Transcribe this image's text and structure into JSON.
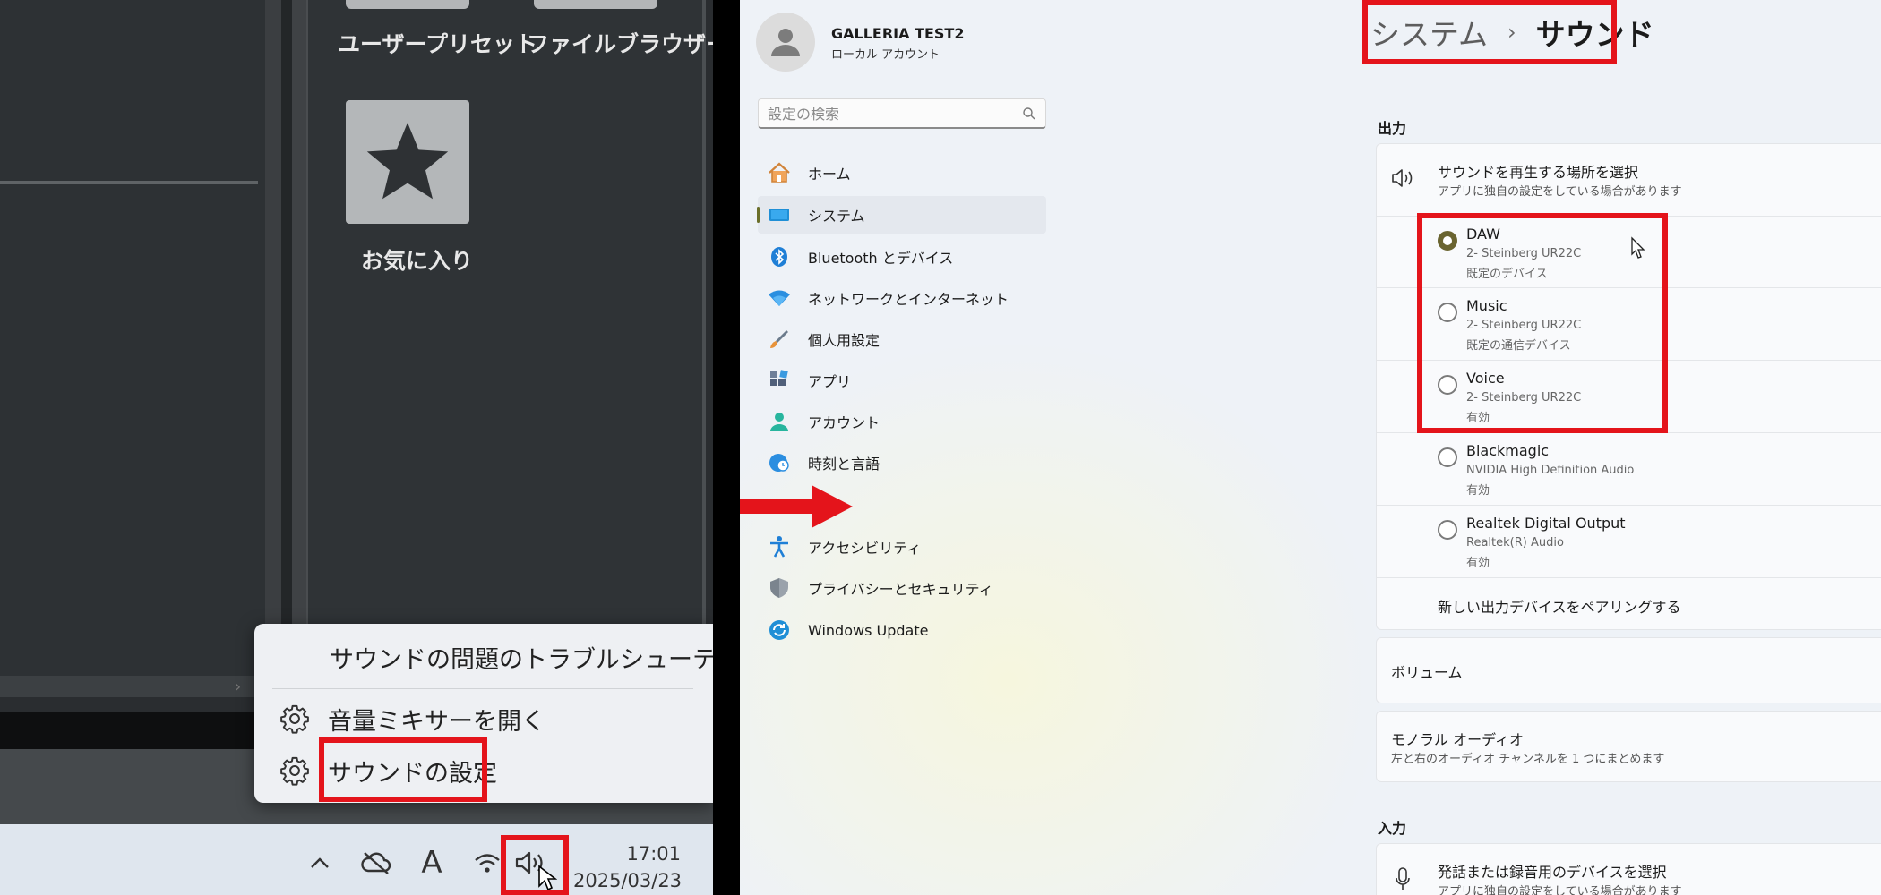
{
  "left": {
    "panel_items": [
      {
        "label": "ユーザープリセット"
      },
      {
        "label": "ファイルブラウザー"
      },
      {
        "label": "お気に入り",
        "icon": "star-icon"
      }
    ],
    "context_menu": {
      "troubleshoot": "サウンドの問題のトラブルシューティング",
      "mixer": "音量ミキサーを開く",
      "settings": "サウンドの設定"
    },
    "taskbar": {
      "ime_glyph": "A",
      "time": "17:01",
      "date": "2025/03/23"
    }
  },
  "settings": {
    "user": {
      "name": "GALLERIA TEST2",
      "account_type": "ローカル アカウント"
    },
    "search": {
      "placeholder": "設定の検索"
    },
    "nav": [
      {
        "label": "ホーム",
        "icon": "home-icon"
      },
      {
        "label": "システム",
        "icon": "system-icon",
        "selected": true
      },
      {
        "label": "Bluetooth とデバイス",
        "icon": "bluetooth-icon"
      },
      {
        "label": "ネットワークとインターネット",
        "icon": "wifi-icon"
      },
      {
        "label": "個人用設定",
        "icon": "brush-icon"
      },
      {
        "label": "アプリ",
        "icon": "apps-icon"
      },
      {
        "label": "アカウント",
        "icon": "account-icon"
      },
      {
        "label": "時刻と言語",
        "icon": "globe-clock-icon"
      },
      {
        "label": "アクセシビリティ",
        "icon": "accessibility-icon"
      },
      {
        "label": "プライバシーとセキュリティ",
        "icon": "shield-icon"
      },
      {
        "label": "Windows Update",
        "icon": "update-icon"
      }
    ],
    "breadcrumb": {
      "parent": "システム",
      "separator": "›",
      "current": "サウンド"
    },
    "output": {
      "heading": "出力",
      "choose_title": "サウンドを再生する場所を選択",
      "choose_sub": "アプリに独自の設定をしている場合があります",
      "devices": [
        {
          "name": "DAW",
          "line1": "2- Steinberg UR22C",
          "line2": "既定のデバイス",
          "selected": true
        },
        {
          "name": "Music",
          "line1": "2- Steinberg UR22C",
          "line2": "既定の通信デバイス",
          "selected": false
        },
        {
          "name": "Voice",
          "line1": "2- Steinberg UR22C",
          "line2": "有効",
          "selected": false
        },
        {
          "name": "Blackmagic",
          "line1": "NVIDIA High Definition Audio",
          "line2": "有効",
          "selected": false
        },
        {
          "name": "Realtek Digital Output",
          "line1": "Realtek(R) Audio",
          "line2": "有効",
          "selected": false
        }
      ],
      "pair_new": "新しい出力デバイスをペアリングする",
      "volume": "ボリューム",
      "mono_title": "モノラル オーディオ",
      "mono_sub": "左と右のオーディオ チャンネルを 1 つにまとめます"
    },
    "input": {
      "heading": "入力",
      "choose_title": "発話または録音用のデバイスを選択",
      "choose_sub": "アプリに独自の設定をしている場合があります"
    }
  },
  "colors": {
    "highlight": "#e4141b",
    "arrow": "#e4141b",
    "radio_selected": "#6a6430"
  }
}
